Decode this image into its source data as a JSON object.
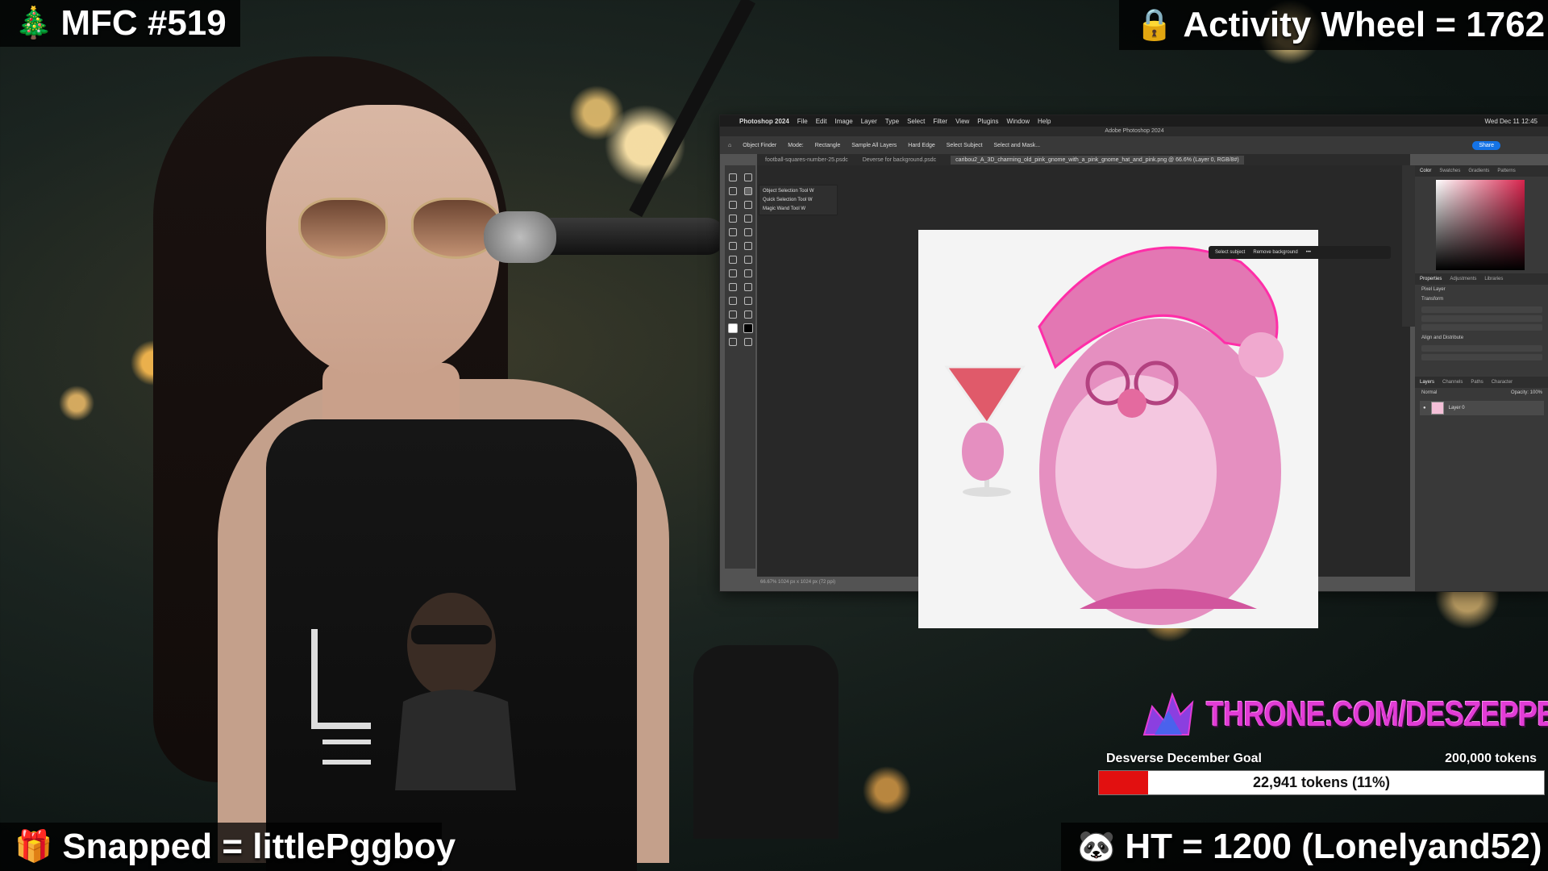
{
  "overlays": {
    "top_left": {
      "icon": "🎄",
      "text": "MFC #519"
    },
    "top_right": {
      "icon": "🔒",
      "text": "Activity Wheel = 1762"
    },
    "bottom_left": {
      "icon": "🎁",
      "text": "Snapped = littlePggboy"
    },
    "bottom_right": {
      "icon": "🐼",
      "text": "HT =  1200 (Lonelyand52)"
    }
  },
  "photoshop": {
    "menu": [
      "Photoshop 2024",
      "File",
      "Edit",
      "Image",
      "Layer",
      "Type",
      "Select",
      "Filter",
      "View",
      "Plugins",
      "Window",
      "Help"
    ],
    "clock": "Wed Dec 11  12:45",
    "window_title": "Adobe Photoshop 2024",
    "options": [
      "Object Finder",
      "Mode:",
      "Rectangle",
      "Sample All Layers",
      "Hard Edge",
      "Select Subject",
      "Select and Mask..."
    ],
    "share_label": "Share",
    "tabs": [
      "football-squares-number-25.psdc",
      "Deverse for background.psdc",
      "caribou2_A_3D_charming_old_pink_gnome_with_a_pink_gnome_hat_and_pink.png @ 66.6% (Layer 0, RGB/8#)"
    ],
    "flyout": [
      "Object Selection Tool   W",
      "Quick Selection Tool   W",
      "Magic Wand Tool   W"
    ],
    "taskbar": [
      "Select subject",
      "Remove background"
    ],
    "status": "66.67%   1024 px x 1024 px (72 ppi)",
    "color_tabs": [
      "Color",
      "Swatches",
      "Gradients",
      "Patterns"
    ],
    "prop_tabs": [
      "Properties",
      "Adjustments",
      "Libraries"
    ],
    "pixel_layer": "Pixel Layer",
    "transform": "Transform",
    "align": "Align and Distribute",
    "layer_tabs": [
      "Layers",
      "Channels",
      "Paths",
      "Character"
    ],
    "blend_mode": "Normal",
    "opacity": "Opacity: 100%",
    "layer_name": "Layer 0"
  },
  "throne": {
    "text": "THRONE.COM/DESZEPPELIN"
  },
  "goal": {
    "name": "Desverse December Goal",
    "target": "200,000 tokens",
    "progress_label": "22,941 tokens (11%)",
    "progress_fraction": 0.11
  },
  "colors": {
    "accent_pink": "#e23cd6",
    "goal_red": "#e21010",
    "ps_blue": "#1473e6"
  }
}
